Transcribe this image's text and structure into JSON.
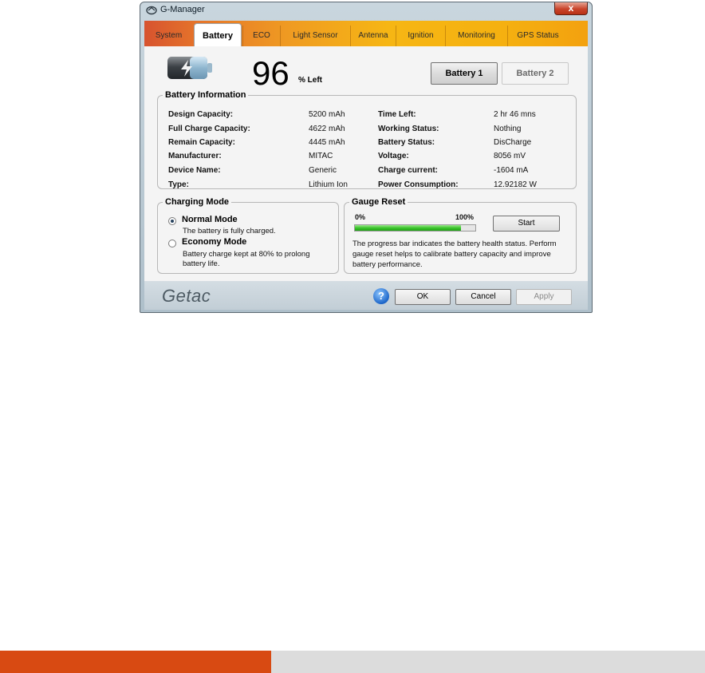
{
  "window": {
    "title": "G-Manager",
    "close_label": "x"
  },
  "tabs": [
    {
      "label": "System"
    },
    {
      "label": "Battery",
      "active": true
    },
    {
      "label": "ECO"
    },
    {
      "label": "Light Sensor"
    },
    {
      "label": "Antenna"
    },
    {
      "label": "Ignition"
    },
    {
      "label": "Monitoring"
    },
    {
      "label": "GPS Status"
    }
  ],
  "battery": {
    "percent": "96",
    "percent_label": "% Left",
    "selector": {
      "battery1": "Battery 1",
      "battery2": "Battery 2",
      "selected": "Battery 1"
    }
  },
  "battery_info": {
    "title": "Battery Information",
    "left": [
      {
        "label": "Design Capacity:",
        "value": "5200 mAh"
      },
      {
        "label": "Full Charge Capacity:",
        "value": "4622 mAh"
      },
      {
        "label": "Remain Capacity:",
        "value": "4445 mAh"
      },
      {
        "label": "Manufacturer:",
        "value": "MITAC"
      },
      {
        "label": "Device Name:",
        "value": "Generic"
      },
      {
        "label": "Type:",
        "value": "Lithium Ion"
      }
    ],
    "right": [
      {
        "label": "Time Left:",
        "value": "2 hr 46 mns"
      },
      {
        "label": "Working Status:",
        "value": "Nothing"
      },
      {
        "label": "Battery Status:",
        "value": "DisCharge"
      },
      {
        "label": "Voltage:",
        "value": "8056 mV"
      },
      {
        "label": "Charge current:",
        "value": "-1604 mA"
      },
      {
        "label": "Power Consumption:",
        "value": "12.92182 W"
      }
    ]
  },
  "charging_mode": {
    "title": "Charging Mode",
    "options": [
      {
        "label": "Normal Mode",
        "desc": "The battery is fully charged.",
        "selected": true
      },
      {
        "label": "Economy Mode",
        "desc": "Battery charge kept at 80% to prolong battery life.",
        "selected": false
      }
    ]
  },
  "gauge_reset": {
    "title": "Gauge Reset",
    "min_label": "0%",
    "max_label": "100%",
    "progress_fraction": 0.88,
    "start_label": "Start",
    "description": "The progress bar indicates the battery health status. Perform gauge reset helps to calibrate battery capacity and improve battery performance."
  },
  "footer": {
    "logo": "Getac",
    "help_icon": "?",
    "ok_label": "OK",
    "cancel_label": "Cancel",
    "apply_label": "Apply"
  },
  "colors": {
    "accent_orange": "#d84a12",
    "progress_green": "#3ac42c"
  }
}
